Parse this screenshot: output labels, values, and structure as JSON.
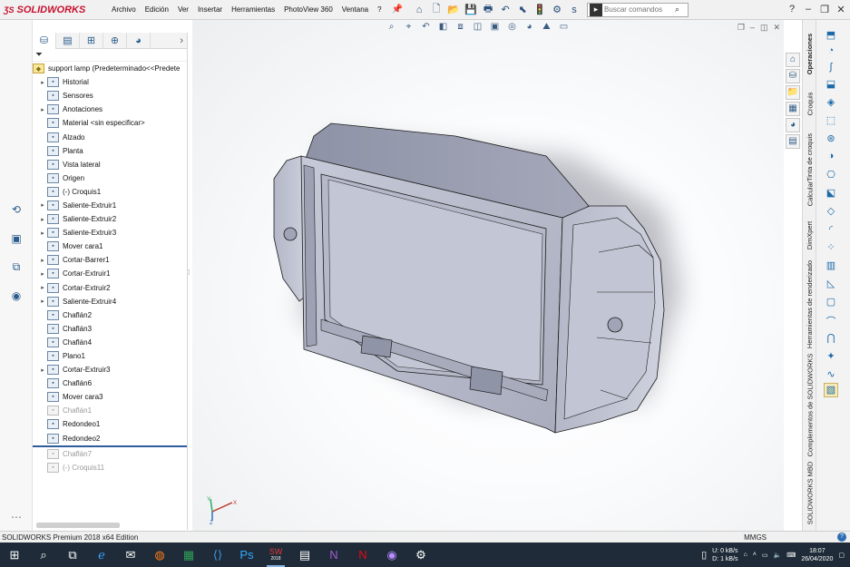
{
  "app": {
    "brand": "SOLIDWORKS",
    "menu": [
      "Archivo",
      "Edición",
      "Ver",
      "Insertar",
      "Herramientas",
      "PhotoView 360",
      "Ventana",
      "?"
    ],
    "search_placeholder": "Buscar comandos",
    "search_scope": "s"
  },
  "feature_tree": {
    "root": "support lamp  (Predeterminado<<Predete",
    "items": [
      {
        "label": "Historial",
        "expandable": true,
        "dim": false
      },
      {
        "label": "Sensores",
        "expandable": false,
        "dim": false
      },
      {
        "label": "Anotaciones",
        "expandable": true,
        "dim": false
      },
      {
        "label": "Material <sin especificar>",
        "expandable": false,
        "dim": false
      },
      {
        "label": "Alzado",
        "expandable": false,
        "dim": false
      },
      {
        "label": "Planta",
        "expandable": false,
        "dim": false
      },
      {
        "label": "Vista lateral",
        "expandable": false,
        "dim": false
      },
      {
        "label": "Origen",
        "expandable": false,
        "dim": false
      },
      {
        "label": "(-) Croquis1",
        "expandable": false,
        "dim": false
      },
      {
        "label": "Saliente-Extruir1",
        "expandable": true,
        "dim": false
      },
      {
        "label": "Saliente-Extruir2",
        "expandable": true,
        "dim": false
      },
      {
        "label": "Saliente-Extruir3",
        "expandable": true,
        "dim": false
      },
      {
        "label": "Mover cara1",
        "expandable": false,
        "dim": false
      },
      {
        "label": "Cortar-Barrer1",
        "expandable": true,
        "dim": false
      },
      {
        "label": "Cortar-Extruir1",
        "expandable": true,
        "dim": false
      },
      {
        "label": "Cortar-Extruir2",
        "expandable": true,
        "dim": false
      },
      {
        "label": "Saliente-Extruir4",
        "expandable": true,
        "dim": false
      },
      {
        "label": "Chaflán2",
        "expandable": false,
        "dim": false
      },
      {
        "label": "Chaflán3",
        "expandable": false,
        "dim": false
      },
      {
        "label": "Chaflán4",
        "expandable": false,
        "dim": false
      },
      {
        "label": "Plano1",
        "expandable": false,
        "dim": false
      },
      {
        "label": "Cortar-Extruir3",
        "expandable": true,
        "dim": false
      },
      {
        "label": "Chaflán6",
        "expandable": false,
        "dim": false
      },
      {
        "label": "Mover cara3",
        "expandable": false,
        "dim": false
      },
      {
        "label": "Chaflán1",
        "expandable": false,
        "dim": true
      },
      {
        "label": "Redondeo1",
        "expandable": false,
        "dim": false
      },
      {
        "label": "Redondeo2",
        "expandable": false,
        "dim": false
      },
      {
        "label": "Chaflán7",
        "expandable": false,
        "dim": true
      },
      {
        "label": "(-) Croquis11",
        "expandable": false,
        "dim": true
      }
    ]
  },
  "task_tabs": [
    "Operaciones",
    "Croquis",
    "Tinta de croquis",
    "Calcular",
    "DimXpert",
    "Herramientas de renderizado",
    "Complementos de SOLIDWORKS",
    "SOLIDWORKS MBD"
  ],
  "status": {
    "edition": "SOLIDWORKS Premium 2018 x64 Edition",
    "units": "MMGS",
    "help": "?"
  },
  "taskbar": {
    "net_up": "0 kB/s",
    "net_down": "1 kB/s",
    "net_up_label": "U:",
    "net_down_label": "D:",
    "time": "18:07",
    "date": "26/04/2020",
    "sw_badge": "2018"
  },
  "triad": {
    "x": "X",
    "y": "Y",
    "z": "Z"
  },
  "colors": {
    "model_fill": "#b8bccb",
    "model_edge": "#1a1a1a",
    "brand_red": "#c8102e",
    "taskbar": "#1f2b38"
  }
}
